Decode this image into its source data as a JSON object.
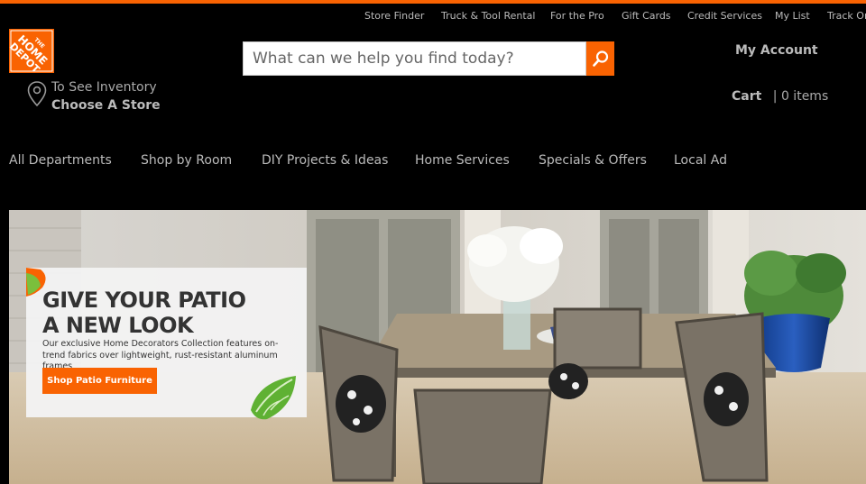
{
  "utility_nav": [
    {
      "label": "Store Finder"
    },
    {
      "label": "Truck & Tool Rental"
    },
    {
      "label": "For the Pro"
    },
    {
      "label": "Gift Cards"
    },
    {
      "label": "Credit Services"
    },
    {
      "label": "My List"
    },
    {
      "label": "Track Or"
    }
  ],
  "logo": {
    "text": "THE HOME DEPOT"
  },
  "search": {
    "placeholder": "What can we help you find today?"
  },
  "account": {
    "label": "My Account"
  },
  "store": {
    "line1": "To See Inventory",
    "line2": "Choose A Store"
  },
  "cart": {
    "label": "Cart",
    "separator": "|",
    "count": "0 items"
  },
  "main_nav": [
    {
      "label": "All Departments"
    },
    {
      "label": "Shop by Room"
    },
    {
      "label": "DIY Projects & Ideas"
    },
    {
      "label": "Home Services"
    },
    {
      "label": "Specials & Offers"
    },
    {
      "label": "Local Ad"
    }
  ],
  "hero": {
    "headline_line1": "GIVE YOUR PATIO",
    "headline_line2": "A NEW LOOK",
    "body": "Our exclusive Home Decorators Collection features on-trend fabrics over lightweight, rust-resistant aluminum frames",
    "cta": "Shop Patio Furniture"
  },
  "colors": {
    "brand": "#f96302",
    "background": "#000000"
  }
}
